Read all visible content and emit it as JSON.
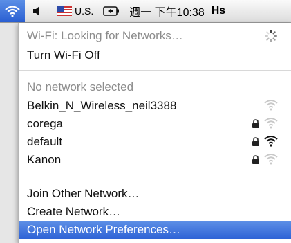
{
  "menubar": {
    "icons": [
      "wifi-icon",
      "speaker-icon",
      "us-flag-icon",
      "battery-icon"
    ],
    "input_source": "U.S.",
    "clock": "週一 下午10:38",
    "user": "Hs"
  },
  "menu": {
    "status": "Wi-Fi: Looking for Networks…",
    "toggle": "Turn Wi-Fi Off",
    "no_network": "No network selected",
    "networks": [
      {
        "name": "Belkin_N_Wireless_neil3388",
        "locked": false,
        "signal": "low"
      },
      {
        "name": "corega",
        "locked": true,
        "signal": "low"
      },
      {
        "name": "default",
        "locked": true,
        "signal": "strong"
      },
      {
        "name": "Kanon",
        "locked": true,
        "signal": "low"
      }
    ],
    "join_other": "Join Other Network…",
    "create": "Create Network…",
    "prefs": "Open Network Preferences…"
  },
  "colors": {
    "highlight": "#2f63d6",
    "menu_bg": "#ffffff",
    "disabled_text": "#8c8c8c"
  }
}
